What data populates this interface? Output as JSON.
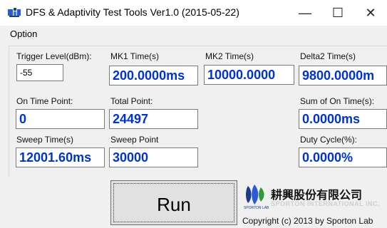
{
  "window": {
    "title": "DFS & Adaptivity Test Tools Ver1.0 (2015-05-22)",
    "minimize": "—",
    "maximize": "☐",
    "close": "✕"
  },
  "menu": {
    "option": "Option"
  },
  "fields": {
    "trigger_level": {
      "label": "Trigger Level(dBm):",
      "value": "-55"
    },
    "mk1_time": {
      "label": "MK1 Time(s)",
      "value": "200.0000ms"
    },
    "mk2_time": {
      "label": "MK2 Time(s)",
      "value": "10000.0000"
    },
    "delta2_time": {
      "label": "Delta2 Time(s)",
      "value": "9800.0000m"
    },
    "on_time_point": {
      "label": "On Time Point:",
      "value": "0"
    },
    "total_point": {
      "label": "Total Point:",
      "value": "24497"
    },
    "sum_on_time": {
      "label": "Sum of On Time(s):",
      "value": "0.0000ms"
    },
    "sweep_time": {
      "label": "Sweep Time(s)",
      "value": "12001.60ms"
    },
    "sweep_point": {
      "label": "Sweep Point",
      "value": "30000"
    },
    "duty_cycle": {
      "label": "Duty Cycle(%):",
      "value": "0.0000%"
    }
  },
  "run_button": {
    "label": "Run"
  },
  "logo": {
    "company_name": "耕興股份有限公司",
    "company_en": "SPORTON INTERNATIONAL INC.",
    "small": "SPORTON LAB",
    "copyright": "Copyright (c) 2013 by Sporton Lab"
  },
  "colors": {
    "value_text": "#0033cc",
    "window_bg": "#f0f0f0",
    "logo_blue": "#1a3a8a",
    "logo_green": "#2e9a3a"
  }
}
